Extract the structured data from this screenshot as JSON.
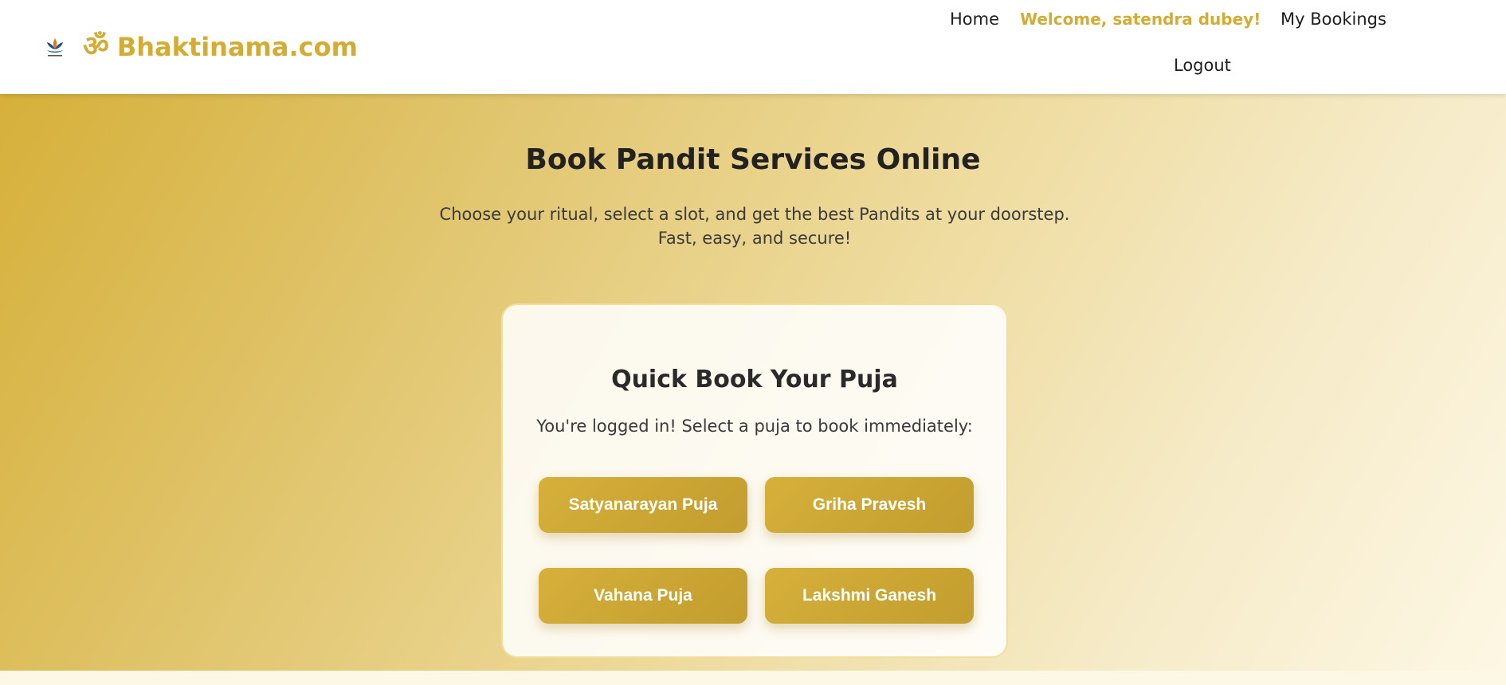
{
  "header": {
    "logo_icon": "lotus-logo-icon",
    "brand_symbol": "ॐ",
    "brand_name": "Bhaktinama.com",
    "nav": {
      "home": "Home",
      "welcome": "Welcome, satendra dubey!",
      "my_bookings": "My Bookings",
      "logout": "Logout"
    }
  },
  "hero": {
    "title": "Book Pandit Services Online",
    "subtitle": "Choose your ritual, select a slot, and get the best Pandits at your doorstep. Fast, easy, and secure!"
  },
  "quick_book": {
    "title": "Quick Book Your Puja",
    "subtitle": "You're logged in! Select a puja to book immediately:",
    "pujas": [
      {
        "label": "Satyanarayan Puja"
      },
      {
        "label": "Griha Pravesh"
      },
      {
        "label": "Vahana Puja"
      },
      {
        "label": "Lakshmi Ganesh"
      }
    ]
  },
  "colors": {
    "brand_gold": "#d4ac34",
    "button_gold": "#c9a22f",
    "text_dark": "#222222"
  }
}
